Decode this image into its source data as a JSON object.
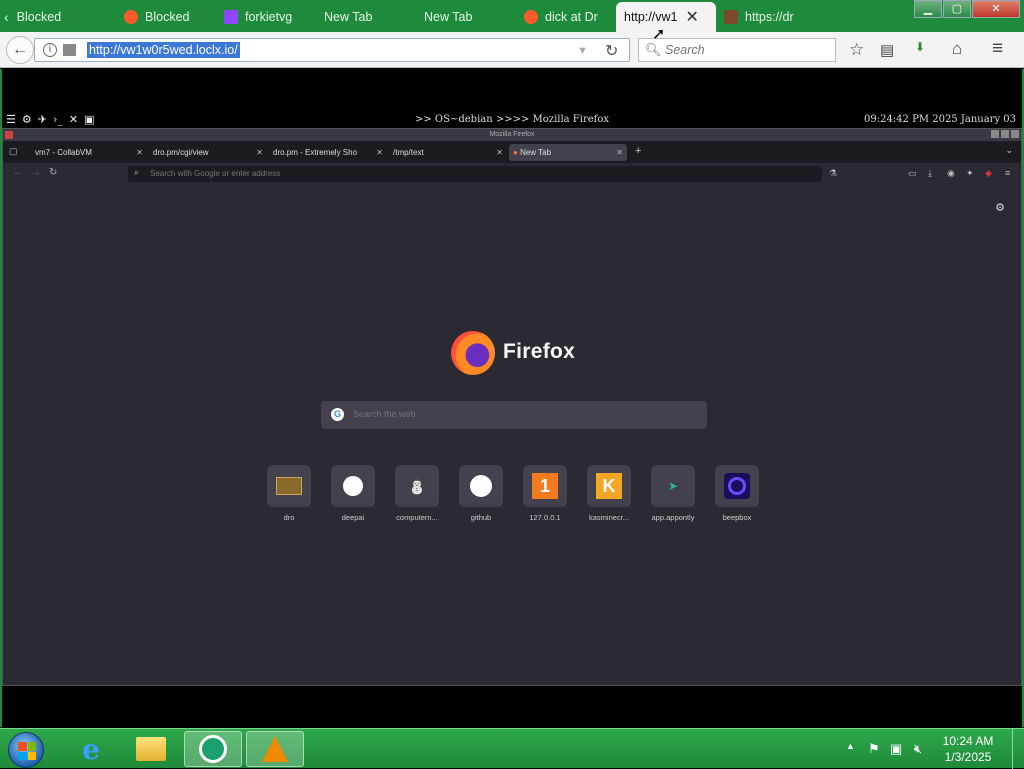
{
  "outer_browser": {
    "tabs": [
      {
        "label": "Blocked",
        "icon": "back-arrow-icon",
        "color": "#1e8a3c"
      },
      {
        "label": "Blocked",
        "icon": "block-icon"
      },
      {
        "label": "forkietvg",
        "icon": "twitch-icon"
      },
      {
        "label": "New Tab",
        "icon": ""
      },
      {
        "label": "New Tab",
        "icon": ""
      },
      {
        "label": "dick at Dr",
        "icon": "block-icon"
      },
      {
        "label": "http://vw1",
        "icon": "",
        "active": true
      },
      {
        "label": "https://dr",
        "icon": "dro-icon"
      }
    ],
    "url": "http://vw1w0r5wed.loclx.io/",
    "search_placeholder": "Search",
    "window_controls": {
      "minimize": "▁",
      "maximize": "▢",
      "close": "✕"
    }
  },
  "linux_panel": {
    "center_text": ">> OS~debian >>>> Mozilla Firefox",
    "clock": "09:24:42 PM 2025 January 03"
  },
  "inner_browser": {
    "window_title": "Mozilla Firefox",
    "tabs": [
      {
        "label": "vm7 - CollabVM"
      },
      {
        "label": "dro.pm/cgi/view"
      },
      {
        "label": "dro.pm - Extremely Sho"
      },
      {
        "label": "/tmp/text"
      },
      {
        "label": "New Tab",
        "active": true
      }
    ],
    "new_tab": "+",
    "url_placeholder": "Search with Google or enter address",
    "brand_name": "Firefox",
    "web_search_placeholder": "Search the web",
    "shortcuts": [
      {
        "label": "dro",
        "icon": "dro-icon"
      },
      {
        "label": "deepai",
        "icon": "deepai-icon"
      },
      {
        "label": "computern...",
        "icon": "computernewb-icon"
      },
      {
        "label": "github",
        "icon": "github-icon"
      },
      {
        "label": "127.0.0.1",
        "icon": "localhost-icon"
      },
      {
        "label": "kasminecr...",
        "icon": "kasm-icon"
      },
      {
        "label": "app.appontly",
        "icon": "appontly-icon"
      },
      {
        "label": "beepbox",
        "icon": "beepbox-icon"
      }
    ]
  },
  "taskbar": {
    "time": "10:24 AM",
    "date": "1/3/2025",
    "apps": [
      "internet-explorer-icon",
      "file-explorer-icon",
      "remote-app-icon",
      "vlc-icon"
    ]
  }
}
